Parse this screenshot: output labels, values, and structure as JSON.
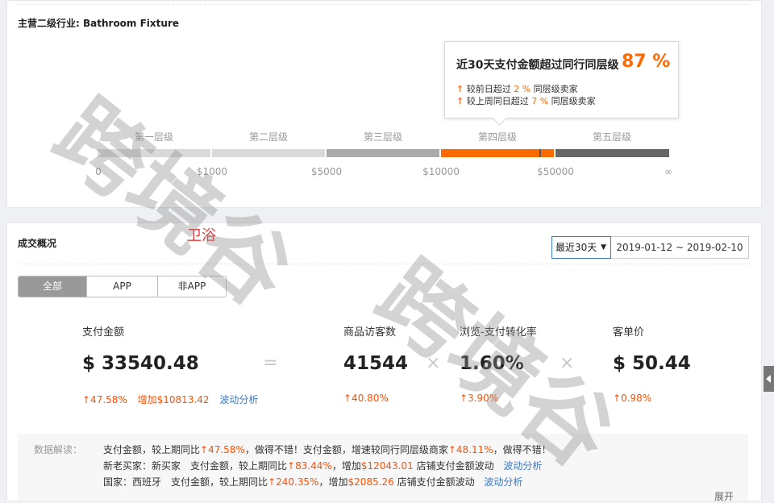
{
  "industry": {
    "label": "主营二级行业:",
    "value": "Bathroom Fixture"
  },
  "tooltip": {
    "title": "近30天支付金额超过同行同层级",
    "percent": "87 %",
    "line1": {
      "prefix": "较前日超过",
      "value": "2 %",
      "suffix": "同层级卖家"
    },
    "line2": {
      "prefix": "较上周同日超过",
      "value": "7 %",
      "suffix": "同层级卖家"
    }
  },
  "tiers": [
    "第一层级",
    "第二层级",
    "第三层级",
    "第四层级",
    "第五层级"
  ],
  "ticks": [
    "0",
    "$1000",
    "$5000",
    "$10000",
    "$50000",
    "∞"
  ],
  "tier_colors": [
    "#d9d9d9",
    "#d9d9d9",
    "#aaaaaa",
    "#ff6a00",
    "#666666"
  ],
  "note": "卫浴",
  "overview": {
    "title": "成交概况",
    "period": "最近30天",
    "period_arrow": "▼",
    "date_range": "2019-01-12 ~ 2019-02-10",
    "segments": [
      "全部",
      "APP",
      "非APP"
    ],
    "selected_segment": "全部"
  },
  "metrics": {
    "pay_amount": {
      "label": "支付金额",
      "value": "$ 33540.48",
      "change": "↑47.58%",
      "increase": "增加$10813.42",
      "link": "波动分析"
    },
    "equals": "=",
    "visitors": {
      "label": "商品访客数",
      "value": "41544",
      "change": "↑40.80%"
    },
    "times1": "×",
    "conversion": {
      "label": "浏览-支付转化率",
      "value": "1.60%",
      "change": "↑3.90%"
    },
    "times2": "×",
    "avg_order": {
      "label": "客单价",
      "value": "$ 50.44",
      "change": "↑0.98%"
    }
  },
  "insights": {
    "label": "数据解读：",
    "line1": {
      "a": "支付金额，较上期同比",
      "b": "↑47.58%",
      "c": "，做得不错！支付金额，增速较同行同层级商家",
      "d": "↑48.11%",
      "e": "，做得不错！"
    },
    "line2": {
      "a": "新老买家：新买家　支付金额，较上期同比",
      "b": "↑83.44%",
      "c": "，增加",
      "d": "$12043.01",
      "e": " 店铺支付金额波动",
      "link": "波动分析"
    },
    "line3": {
      "a": "国家：西班牙　支付金额，较上期同比",
      "b": "↑240.35%",
      "c": "，增加",
      "d": "$2085.26",
      "e": " 店铺支付金额波动",
      "link": "波动分析"
    },
    "expand": "展开"
  },
  "watermark": {
    "text1": "跨境谷",
    "text2": "跨境谷"
  }
}
